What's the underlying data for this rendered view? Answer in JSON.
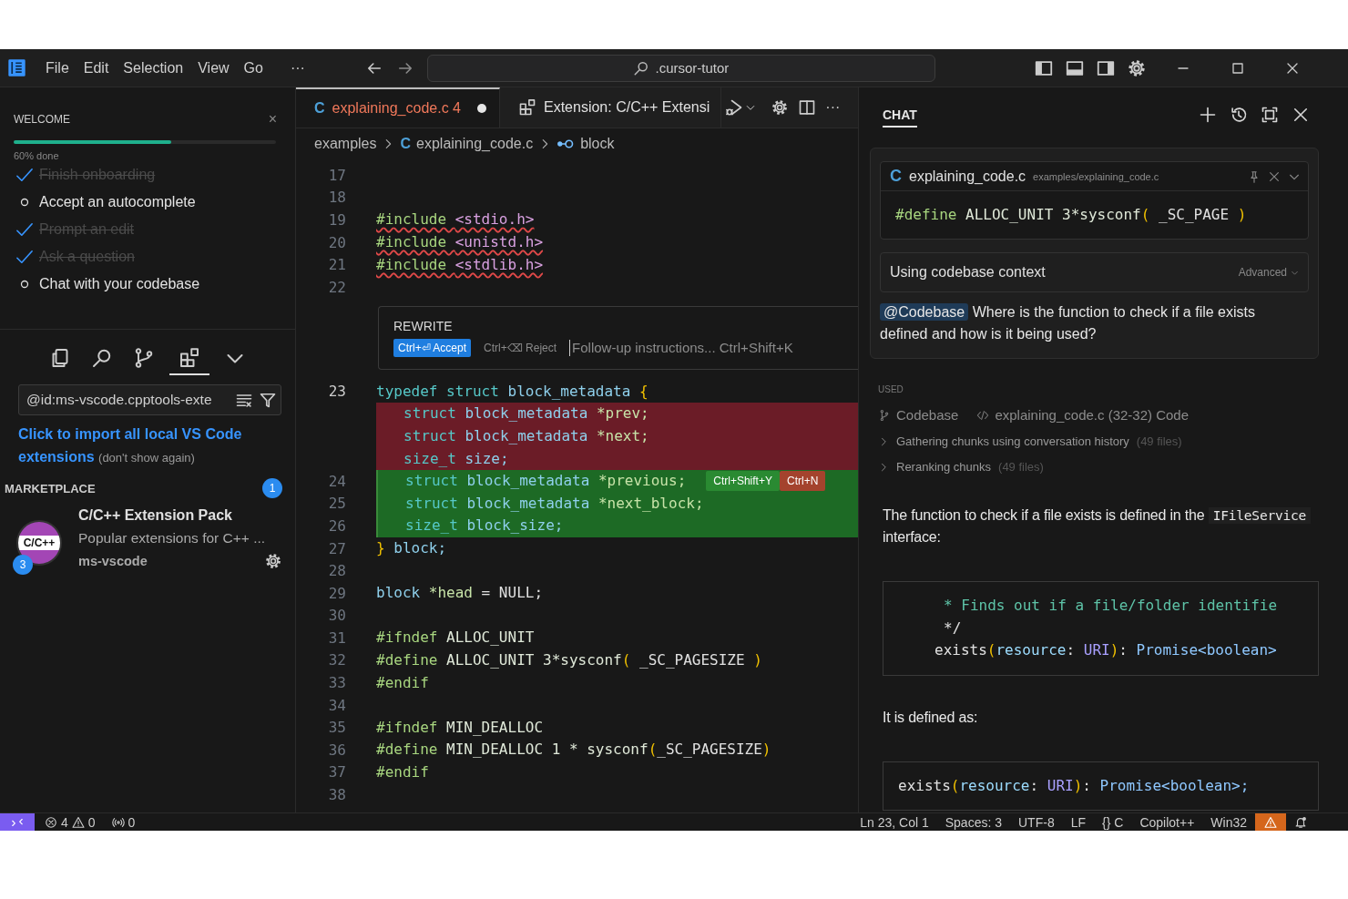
{
  "title_bar": {
    "menus": [
      "File",
      "Edit",
      "Selection",
      "View",
      "Go"
    ],
    "more": "···",
    "command_center": {
      "value": ".cursor-tutor"
    }
  },
  "sidebar": {
    "welcome": {
      "title": "WELCOME",
      "close": "×",
      "progress": {
        "level": 0.6,
        "label": "60% done"
      },
      "steps": [
        {
          "label": "Finish onboarding",
          "done": true
        },
        {
          "label": "Accept an autocomplete",
          "done": false
        },
        {
          "label": "Prompt an edit",
          "done": true
        },
        {
          "label": "Ask a question",
          "done": true
        },
        {
          "label": "Chat with your codebase",
          "done": false
        }
      ]
    },
    "view_tabs": [
      {
        "kind": "explorer",
        "selected": false
      },
      {
        "kind": "search",
        "selected": false
      },
      {
        "kind": "source_control",
        "selected": false
      },
      {
        "kind": "extensions",
        "selected": true
      },
      {
        "kind": "more",
        "selected": false
      }
    ],
    "search": {
      "value": "@id:ms-vscode.cpptools-exte"
    },
    "import_notice": {
      "link": "Click to import all local VS Code extensions",
      "dismiss": "(don't show again)"
    },
    "marketplace": {
      "title": "MARKETPLACE",
      "badge": "1",
      "extensions": [
        {
          "logo": "C/C++",
          "badge": "3",
          "name": "C/C++ Extension Pack",
          "description": "Popular extensions for C++ ...",
          "publisher": "ms-vscode"
        }
      ]
    }
  },
  "editor": {
    "tabs": [
      {
        "kind": "file",
        "icon": "C",
        "label": "explaining_code.c",
        "problems": "4",
        "modified": true,
        "selected": true
      },
      {
        "kind": "extension",
        "label": "Extension: C/C++ Extensi",
        "selected": false
      }
    ],
    "more": "···",
    "breadcrumb": [
      {
        "kind": "folder",
        "label": "examples"
      },
      {
        "kind": "file",
        "icon": "C",
        "label": "explaining_code.c"
      },
      {
        "kind": "symbol",
        "label": "block"
      }
    ],
    "lines": [
      {
        "kind": "normal",
        "number": "17"
      },
      {
        "kind": "normal",
        "number": "18"
      },
      {
        "kind": "normal",
        "number": "19",
        "error": true,
        "tokens": [
          {
            "kind": "pp",
            "text": "#include "
          },
          {
            "kind": "inc",
            "text": "<stdio.h>"
          }
        ]
      },
      {
        "kind": "normal",
        "number": "20",
        "error": true,
        "tokens": [
          {
            "kind": "pp",
            "text": "#include "
          },
          {
            "kind": "inc",
            "text": "<unistd.h>"
          }
        ]
      },
      {
        "kind": "normal",
        "number": "21",
        "error": true,
        "tokens": [
          {
            "kind": "pp",
            "text": "#include "
          },
          {
            "kind": "inc",
            "text": "<stdlib.h>"
          }
        ]
      },
      {
        "kind": "normal",
        "number": "22"
      },
      {
        "kind": "rewrite",
        "title": "REWRITE",
        "accept": "Ctrl+⏎ Accept",
        "reject": "Ctrl+⌫ Reject",
        "placeholder": "Follow-up instructions... Ctrl+Shift+K"
      },
      {
        "kind": "normal",
        "number": "23",
        "current": true,
        "tokens": [
          {
            "kind": "kw",
            "text": "typedef struct "
          },
          {
            "kind": "ty",
            "text": "block_metadata "
          },
          {
            "kind": "br",
            "text": "{"
          }
        ]
      },
      {
        "kind": "deleted",
        "indent": true,
        "tokens": [
          {
            "kind": "kw",
            "text": "struct "
          },
          {
            "kind": "ty",
            "text": "block_metadata "
          },
          {
            "kind": "id",
            "text": "*prev;"
          }
        ]
      },
      {
        "kind": "deleted",
        "indent": true,
        "tokens": [
          {
            "kind": "kw",
            "text": "struct "
          },
          {
            "kind": "ty",
            "text": "block_metadata "
          },
          {
            "kind": "id",
            "text": "*next;"
          }
        ]
      },
      {
        "kind": "deleted",
        "indent": true,
        "tokens": [
          {
            "kind": "kw",
            "text": "size_t "
          },
          {
            "kind": "ty",
            "text": "size;"
          }
        ]
      },
      {
        "kind": "added",
        "number": "24",
        "indent": true,
        "tokens": [
          {
            "kind": "kw",
            "text": "struct "
          },
          {
            "kind": "ty",
            "text": "block_metadata "
          },
          {
            "kind": "id",
            "text": "*previous;"
          }
        ],
        "actions": [
          {
            "kind": "accept",
            "label": "Ctrl+Shift+Y"
          },
          {
            "kind": "reject",
            "label": "Ctrl+N"
          }
        ]
      },
      {
        "kind": "added",
        "number": "25",
        "indent": true,
        "tokens": [
          {
            "kind": "kw",
            "text": "struct "
          },
          {
            "kind": "ty",
            "text": "block_metadata "
          },
          {
            "kind": "id",
            "text": "*next_block;"
          }
        ]
      },
      {
        "kind": "added",
        "number": "26",
        "indent": true,
        "tokens": [
          {
            "kind": "kw",
            "text": "size_t "
          },
          {
            "kind": "ty",
            "text": "block_size;"
          }
        ]
      },
      {
        "kind": "normal",
        "number": "27",
        "tokens": [
          {
            "kind": "br",
            "text": "} "
          },
          {
            "kind": "ty",
            "text": "block;"
          }
        ]
      },
      {
        "kind": "normal",
        "number": "28"
      },
      {
        "kind": "normal",
        "number": "29",
        "tokens": [
          {
            "kind": "ty",
            "text": "block "
          },
          {
            "kind": "id",
            "text": "*head"
          },
          {
            "kind": "op",
            "text": " = NULL;"
          }
        ]
      },
      {
        "kind": "normal",
        "number": "30"
      },
      {
        "kind": "normal",
        "number": "31",
        "tokens": [
          {
            "kind": "pp",
            "text": "#ifndef"
          },
          {
            "kind": "mac",
            "text": " ALLOC_UNIT"
          }
        ]
      },
      {
        "kind": "normal",
        "number": "32",
        "tokens": [
          {
            "kind": "pp",
            "text": "#define"
          },
          {
            "kind": "mac",
            "text": " ALLOC_UNIT 3*sysconf"
          },
          {
            "kind": "br",
            "text": "("
          },
          {
            "kind": "op",
            "text": " _SC_PAGESIZE "
          },
          {
            "kind": "br",
            "text": ")"
          }
        ]
      },
      {
        "kind": "normal",
        "number": "33",
        "tokens": [
          {
            "kind": "pp",
            "text": "#endif"
          }
        ]
      },
      {
        "kind": "normal",
        "number": "34"
      },
      {
        "kind": "normal",
        "number": "35",
        "tokens": [
          {
            "kind": "pp",
            "text": "#ifndef"
          },
          {
            "kind": "mac",
            "text": " MIN_DEALLOC"
          }
        ]
      },
      {
        "kind": "normal",
        "number": "36",
        "tokens": [
          {
            "kind": "pp",
            "text": "#define"
          },
          {
            "kind": "mac",
            "text": " MIN_DEALLOC 1 * sysconf"
          },
          {
            "kind": "br",
            "text": "("
          },
          {
            "kind": "op",
            "text": "_SC_PAGESIZE"
          },
          {
            "kind": "br",
            "text": ")"
          }
        ]
      },
      {
        "kind": "normal",
        "number": "37",
        "tokens": [
          {
            "kind": "pp",
            "text": "#endif"
          }
        ]
      },
      {
        "kind": "normal",
        "number": "38"
      }
    ]
  },
  "chat": {
    "tab": {
      "label": "CHAT",
      "selected": true
    },
    "query": {
      "file": {
        "icon": "C",
        "name": "explaining_code.c",
        "path": "examples/explaining_code.c",
        "code": [
          {
            "kind": "pp",
            "text": "#define"
          },
          {
            "kind": "mac",
            "text": " ALLOC_UNIT 3*sysconf"
          },
          {
            "kind": "br",
            "text": "("
          },
          {
            "kind": "op",
            "text": " _SC_PAGE "
          },
          {
            "kind": "br",
            "text": ")"
          }
        ]
      },
      "context": {
        "label": "Using codebase context",
        "mode": "Advanced"
      },
      "message": {
        "mention": "@Codebase",
        "text": "Where is the function to check if a file exists defined and how is it being used?"
      }
    },
    "used": {
      "title": "USED",
      "sources": [
        {
          "kind": "codebase",
          "label": "Codebase"
        },
        {
          "kind": "code",
          "label": "explaining_code.c (32-32) Code"
        }
      ],
      "steps": [
        {
          "label": "Gathering chunks using conversation history",
          "count": "(49 files)",
          "expanded": false
        },
        {
          "label": "Reranking chunks",
          "count": "(49 files)",
          "expanded": false
        }
      ]
    },
    "answer": [
      {
        "kind": "paragraph",
        "parts": [
          {
            "text": "The function to check if a file exists is defined in the"
          },
          {
            "code": "IFileService"
          },
          {
            "text": "interface:"
          }
        ]
      },
      {
        "kind": "code",
        "lines": [
          {
            "kind": "deep",
            "tokens": [
              {
                "kind": "cm",
                "text": "* Finds out if a file/folder identifie"
              }
            ]
          },
          {
            "kind": "deep",
            "tokens": [
              {
                "kind": "op",
                "text": "*/"
              }
            ]
          },
          {
            "kind": "mid",
            "tokens": [
              {
                "kind": "op",
                "text": "exists"
              },
              {
                "kind": "br",
                "text": "("
              },
              {
                "kind": "prop",
                "text": "resource"
              },
              {
                "kind": "op",
                "text": ": "
              },
              {
                "kind": "cls",
                "text": "URI"
              },
              {
                "kind": "br",
                "text": ")"
              },
              {
                "kind": "op",
                "text": ": "
              },
              {
                "kind": "typ",
                "text": "Promise<boolean>"
              }
            ]
          }
        ]
      },
      {
        "kind": "paragraph",
        "parts": [
          {
            "text": "It is defined as:"
          }
        ]
      },
      {
        "kind": "code",
        "lines": [
          {
            "kind": "flat",
            "tokens": [
              {
                "kind": "op",
                "text": "exists"
              },
              {
                "kind": "br",
                "text": "("
              },
              {
                "kind": "prop",
                "text": "resource"
              },
              {
                "kind": "op",
                "text": ": "
              },
              {
                "kind": "cls",
                "text": "URI"
              },
              {
                "kind": "br",
                "text": ")"
              },
              {
                "kind": "op",
                "text": ": "
              },
              {
                "kind": "typ",
                "text": "Promise<boolean>;"
              }
            ]
          }
        ]
      }
    ]
  },
  "status_bar": {
    "left": [
      {
        "kind": "remote"
      },
      {
        "kind": "problems",
        "errors": "4",
        "warnings": "0"
      },
      {
        "kind": "ports",
        "label": "0"
      }
    ],
    "right": [
      {
        "kind": "text",
        "label": "Ln 23, Col 1"
      },
      {
        "kind": "text",
        "label": "Spaces: 3"
      },
      {
        "kind": "text",
        "label": "UTF-8"
      },
      {
        "kind": "text",
        "label": "LF"
      },
      {
        "kind": "language",
        "icon": "{}",
        "label": "C"
      },
      {
        "kind": "text",
        "label": "Copilot++"
      },
      {
        "kind": "text",
        "label": "Win32"
      },
      {
        "kind": "warning"
      },
      {
        "kind": "notifications"
      }
    ]
  }
}
